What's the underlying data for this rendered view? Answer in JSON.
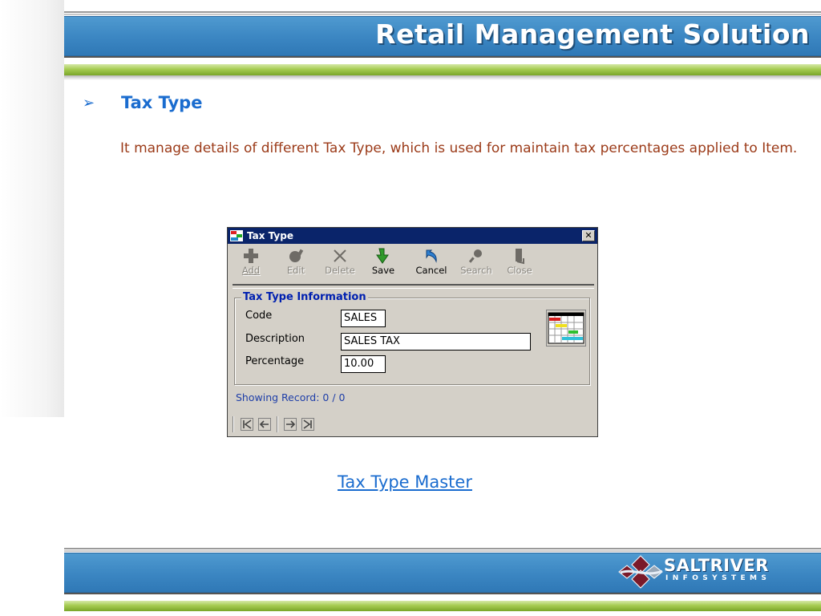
{
  "slide": {
    "header_title": "Retail Management Solution",
    "heading": "Tax Type",
    "description": "It manage details of different Tax Type, which is used for maintain tax percentages applied to Item.",
    "caption": "Tax Type Master",
    "footer_logo_name": "SALTRIVER",
    "footer_logo_sub": "INFOSYSTEMS"
  },
  "colors": {
    "header_blue": "#3b86c2",
    "accent_green": "#a6cc52",
    "heading_blue": "#1a6ccf",
    "body_text": "#9b3a18",
    "dialog_title_bar": "#0a246a"
  },
  "dialog": {
    "title": "Tax Type",
    "close_glyph": "✕",
    "toolbar": [
      {
        "key": "add",
        "label": "Add",
        "icon": "plus-icon",
        "enabled": false
      },
      {
        "key": "edit",
        "label": "Edit",
        "icon": "edit-icon",
        "enabled": false
      },
      {
        "key": "delete",
        "label": "Delete",
        "icon": "x-icon",
        "enabled": false
      },
      {
        "key": "save",
        "label": "Save",
        "icon": "green-arrow-down-icon",
        "enabled": true
      },
      {
        "key": "cancel",
        "label": "Cancel",
        "icon": "undo-arrow-icon",
        "enabled": true
      },
      {
        "key": "search",
        "label": "Search",
        "icon": "magnifier-icon",
        "enabled": false
      },
      {
        "key": "close",
        "label": "Close",
        "icon": "door-exit-icon",
        "enabled": false
      }
    ],
    "group_title": "Tax Type Information",
    "fields": {
      "code_label": "Code",
      "code_value": "SALES",
      "description_label": "Description",
      "description_value": "SALES TAX",
      "percentage_label": "Percentage",
      "percentage_value": "10.00"
    },
    "status": "Showing Record: 0 / 0",
    "nav_buttons": [
      "first-record-icon",
      "prev-record-icon",
      "next-record-icon",
      "last-record-icon"
    ]
  }
}
